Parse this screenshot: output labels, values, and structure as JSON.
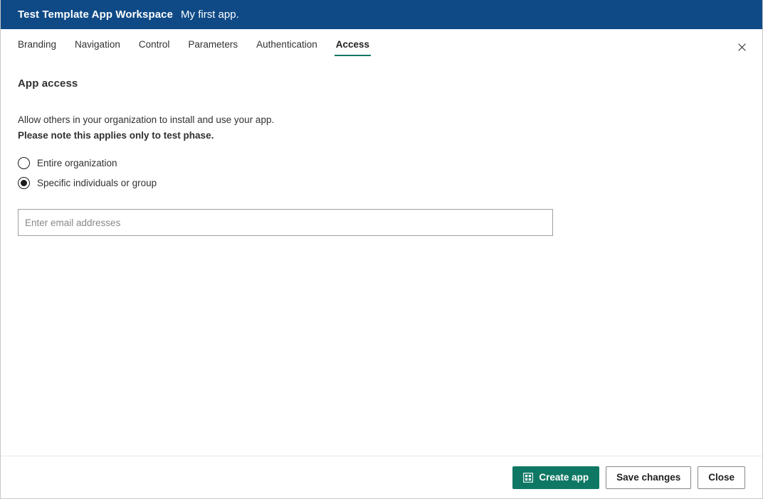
{
  "header": {
    "workspace_title": "Test Template App Workspace",
    "app_subtitle": "My first app.",
    "background_color": "#0f4a86",
    "close_icon": "close-icon"
  },
  "tabs": [
    {
      "label": "Branding",
      "active": false
    },
    {
      "label": "Navigation",
      "active": false
    },
    {
      "label": "Control",
      "active": false
    },
    {
      "label": "Parameters",
      "active": false
    },
    {
      "label": "Authentication",
      "active": false
    },
    {
      "label": "Access",
      "active": true
    }
  ],
  "active_tab_accent_color": "#0f7864",
  "main": {
    "section_title": "App access",
    "description": "Allow others in your organization to install and use your app.",
    "description_bold": "Please note this applies only to test phase.",
    "radio_options": [
      {
        "label": "Entire organization",
        "selected": false
      },
      {
        "label": "Specific individuals or group",
        "selected": true
      }
    ],
    "email_input": {
      "value": "",
      "placeholder": "Enter email addresses"
    }
  },
  "footer": {
    "create_app_label": "Create app",
    "create_app_icon": "app-grid-icon",
    "create_app_color": "#0f7864",
    "save_changes_label": "Save changes",
    "close_label": "Close"
  }
}
